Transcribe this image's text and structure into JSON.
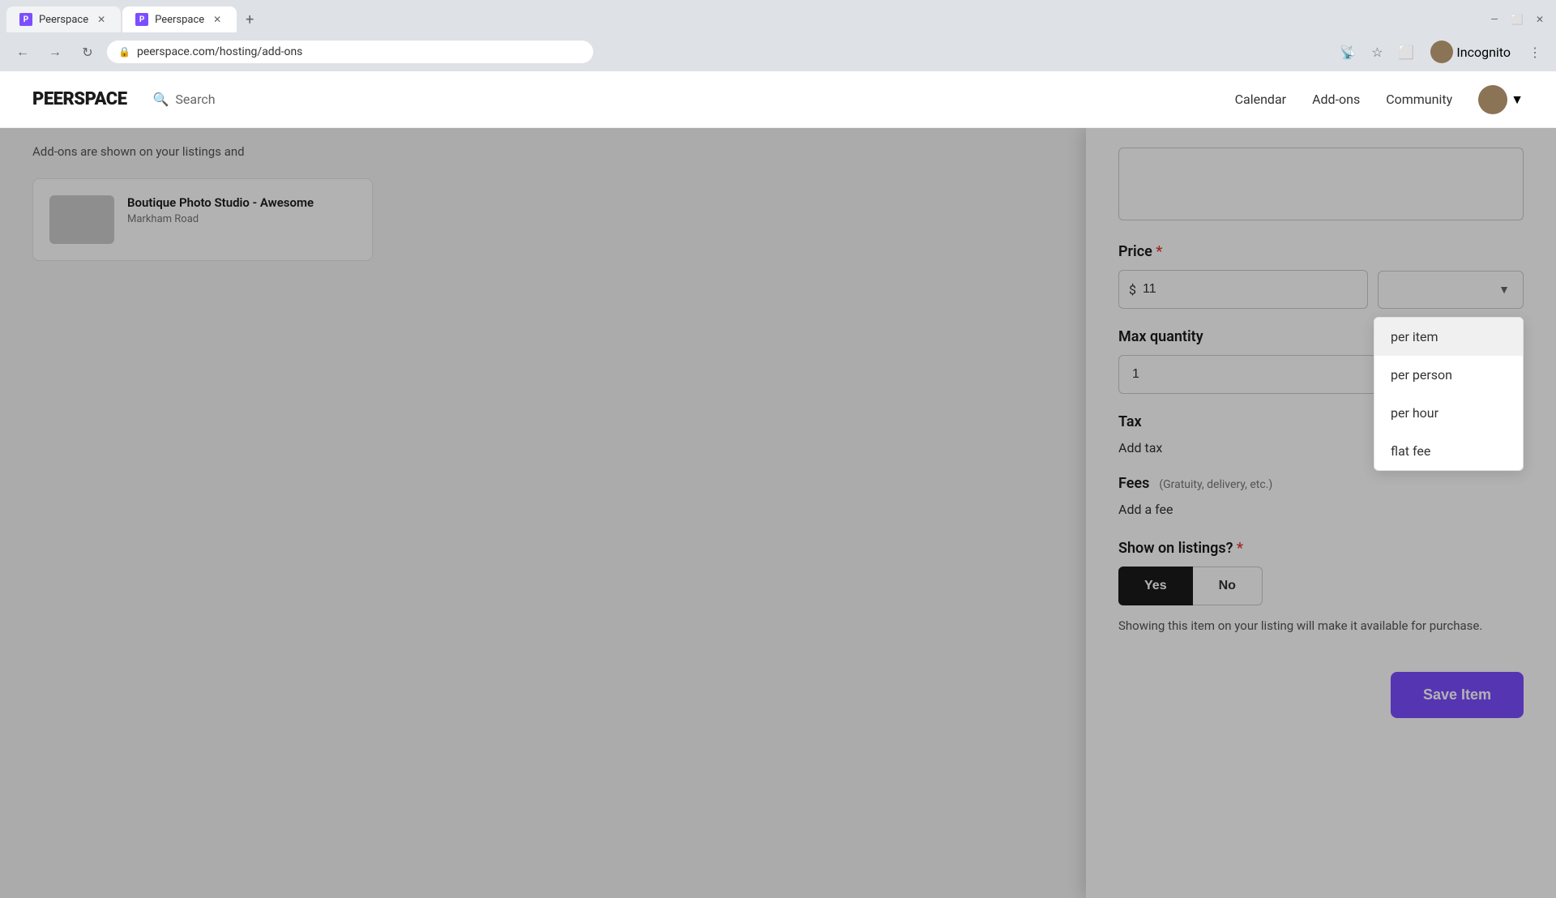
{
  "browser": {
    "tabs": [
      {
        "label": "Peerspace",
        "active": false,
        "url": ""
      },
      {
        "label": "Peerspace",
        "active": true,
        "url": "peerspace.com/hosting/add-ons"
      }
    ],
    "url": "peerspace.com/hosting/add-ons",
    "new_tab_label": "+",
    "profile_label": "Incognito"
  },
  "nav": {
    "logo": "PEERSPACE",
    "search_label": "Search",
    "links": [
      "Calendar",
      "Add-ons",
      "Community"
    ]
  },
  "breadcrumb": "Add-ons are shown on your listings and",
  "listing_card": {
    "title": "Boutique Photo Studio - Awesome",
    "address": "Markham Road"
  },
  "modal": {
    "description_placeholder": "",
    "price_label": "Price",
    "price_required": "*",
    "currency_symbol": "$",
    "price_value": "11",
    "dropdown_current": "",
    "dropdown_options": [
      {
        "label": "per item",
        "highlighted": true
      },
      {
        "label": "per person",
        "highlighted": false
      },
      {
        "label": "per hour",
        "highlighted": false
      },
      {
        "label": "flat fee",
        "highlighted": false
      }
    ],
    "max_quantity_label": "Max quantity",
    "max_quantity_value": "1",
    "tax_label": "Tax",
    "add_tax_label": "Add tax",
    "fees_label": "Fees",
    "fees_sublabel": "(Gratuity, delivery, etc.)",
    "add_fee_label": "Add a fee",
    "show_listings_label": "Show on listings?",
    "show_listings_required": "*",
    "yes_label": "Yes",
    "no_label": "No",
    "show_description": "Showing this item on your listing will make it available for purchase.",
    "save_label": "Save Item"
  }
}
